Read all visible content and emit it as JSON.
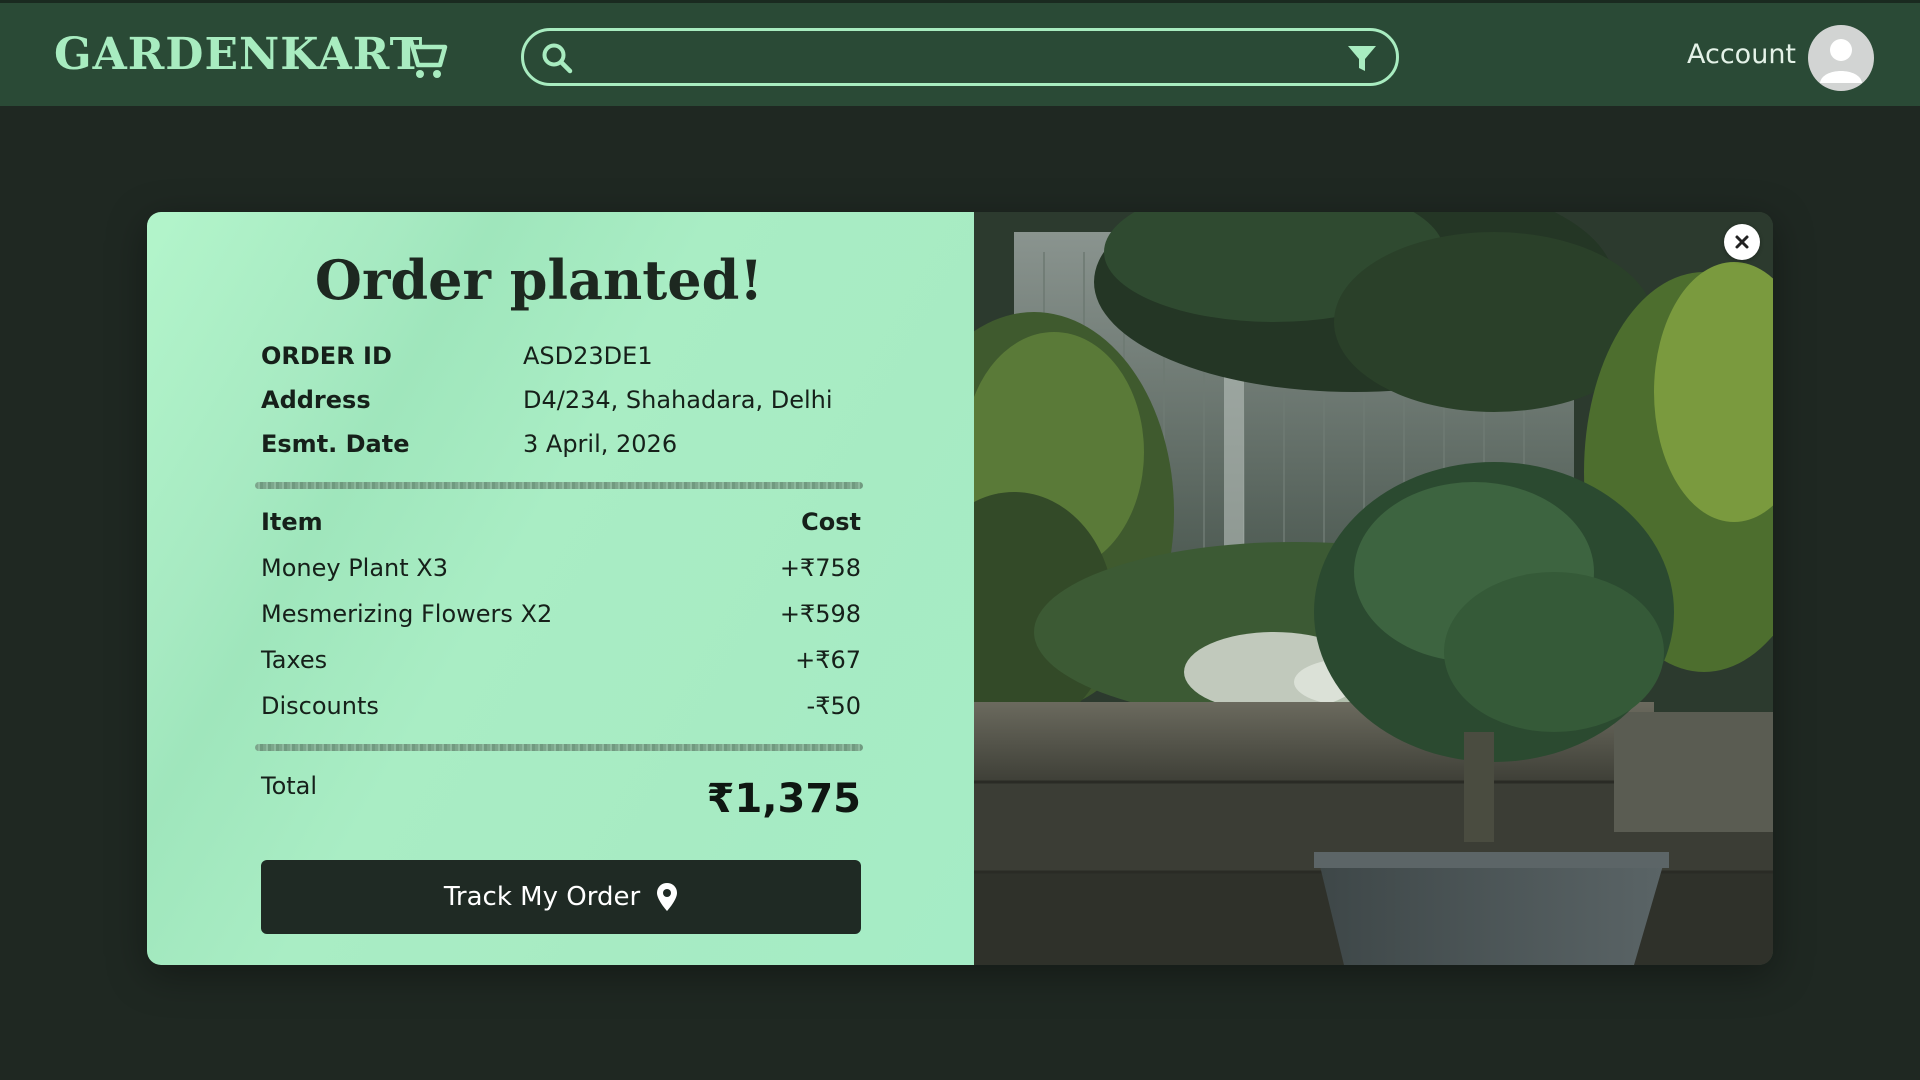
{
  "header": {
    "logo": "GARDENKART",
    "cart_icon": "cart-icon",
    "search": {
      "value": "",
      "placeholder": "",
      "icon": "search-icon",
      "filter_icon": "filter-icon"
    },
    "account_label": "Account",
    "avatar_icon": "user-avatar-icon"
  },
  "modal": {
    "title": "Order planted!",
    "close_icon": "close-icon",
    "info": [
      {
        "label": "ORDER ID",
        "value": "ASD23DE1"
      },
      {
        "label": "Address",
        "value": "D4/234, Shahadara, Delhi"
      },
      {
        "label": "Esmt. Date",
        "value": "3 April, 2026"
      }
    ],
    "table_header": {
      "item": "Item",
      "cost": "Cost"
    },
    "line_items": [
      {
        "item": "Money Plant X3",
        "cost": "+₹758"
      },
      {
        "item": "Mesmerizing Flowers X2",
        "cost": "+₹598"
      },
      {
        "item": "Taxes",
        "cost": "+₹67"
      },
      {
        "item": "Discounts",
        "cost": "-₹50"
      }
    ],
    "total_label": "Total",
    "total_value": "₹1,375",
    "track_button_label": "Track My Order",
    "track_button_icon": "location-pin-icon",
    "photo_description": "garden-plants-photo"
  },
  "colors": {
    "topbar_bg": "#2a4a36",
    "page_bg": "#1f2822",
    "accent": "#a8ecc0",
    "panel_bg": "#a7ebc3",
    "button_bg": "#1f2a24"
  }
}
